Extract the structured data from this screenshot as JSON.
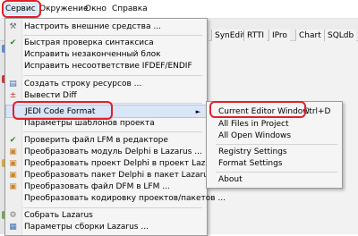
{
  "menubar": {
    "items": [
      "Сервис",
      "Окружение",
      "Окно",
      "Справка"
    ]
  },
  "ide_tabs": [
    "SynEdit",
    "RTTI",
    "IPro",
    "Chart",
    "SQLdb"
  ],
  "service_menu": {
    "items": [
      {
        "label": "Настроить внешние средства ...",
        "icon": "tools-icon"
      },
      {
        "label": "Быстрая проверка синтаксиса",
        "icon": "check-icon"
      },
      {
        "label": "Исправить незаконченный блок",
        "icon": ""
      },
      {
        "label": "Исправить несоответствие IFDEF/ENDIF",
        "icon": ""
      },
      {
        "label": "Создать строку ресурсов ...",
        "icon": "resource-icon"
      },
      {
        "label": "Вывести Diff",
        "icon": "diff-icon"
      },
      {
        "label": "JEDI Code Format",
        "icon": "",
        "has_submenu": true
      },
      {
        "label": "Параметры шаблонов проекта",
        "icon": ""
      },
      {
        "label": "Проверить файл LFM в редакторе",
        "icon": "check-icon"
      },
      {
        "label": "Преобразовать модуль Delphi в Lazarus ...",
        "icon": "convert-icon"
      },
      {
        "label": "Преобразовать проект Delphi в проект Lazarus ...",
        "icon": "convert-icon"
      },
      {
        "label": "Преобразовать пакет Delphi в пакет Lazarus ...",
        "icon": "convert-icon"
      },
      {
        "label": "Преобразовать файл DFM в LFM ...",
        "icon": "convert-icon"
      },
      {
        "label": "Преобразовать кодировку проектов/пакетов ...",
        "icon": ""
      },
      {
        "label": "Собрать Lazarus",
        "icon": "build-icon"
      },
      {
        "label": "Параметры сборки Lazarus ...",
        "icon": "build-options-icon"
      }
    ]
  },
  "jedi_submenu": {
    "items": [
      {
        "label": "Current Editor Window",
        "shortcut": "Ctrl+D"
      },
      {
        "label": "All Files in Project",
        "shortcut": ""
      },
      {
        "label": "All Open Windows",
        "shortcut": ""
      },
      {
        "label": "Registry Settings",
        "shortcut": ""
      },
      {
        "label": "Format Settings",
        "shortcut": ""
      },
      {
        "label": "About",
        "shortcut": ""
      }
    ]
  },
  "colors": {
    "annotation": "#e3202a",
    "highlight": "#d8e6f8"
  }
}
